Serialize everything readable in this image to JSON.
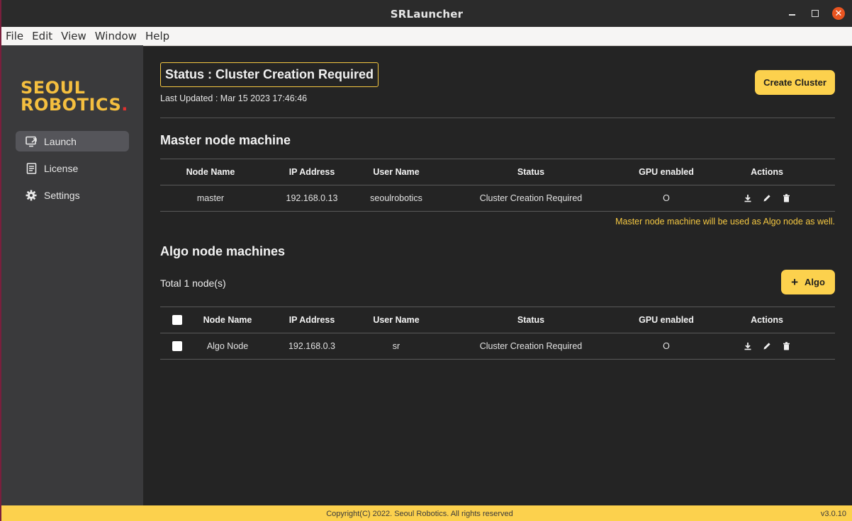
{
  "window": {
    "title": "SRLauncher"
  },
  "menu": {
    "items": [
      "File",
      "Edit",
      "View",
      "Window",
      "Help"
    ]
  },
  "sidebar": {
    "logo_line1": "SEOUL",
    "logo_line2": "ROBOTICS",
    "logo_dot": ".",
    "items": [
      {
        "label": "Launch",
        "icon": "launch-icon",
        "active": true
      },
      {
        "label": "License",
        "icon": "license-icon",
        "active": false
      },
      {
        "label": "Settings",
        "icon": "gear-icon",
        "active": false
      }
    ]
  },
  "header": {
    "status": "Status : Cluster Creation Required",
    "last_updated": "Last Updated : Mar 15 2023 17:46:46",
    "create_button": "Create Cluster"
  },
  "master": {
    "title": "Master node machine",
    "columns": [
      "Node Name",
      "IP Address",
      "User Name",
      "Status",
      "GPU enabled",
      "Actions"
    ],
    "rows": [
      {
        "node_name": "master",
        "ip": "192.168.0.13",
        "user": "seoulrobotics",
        "status": "Cluster Creation Required",
        "gpu": "O"
      }
    ],
    "note": "Master node machine will be used as Algo node as well."
  },
  "algo": {
    "title": "Algo node machines",
    "total": "Total 1 node(s)",
    "add_button": "Algo",
    "columns": [
      "Node Name",
      "IP Address",
      "User Name",
      "Status",
      "GPU enabled",
      "Actions"
    ],
    "rows": [
      {
        "node_name": "Algo Node",
        "ip": "192.168.0.3",
        "user": "sr",
        "status": "Cluster Creation Required",
        "gpu": "O"
      }
    ]
  },
  "footer": {
    "copyright": "Copyright(C) 2022. Seoul Robotics. All rights reserved",
    "version": "v3.0.10"
  },
  "colors": {
    "accent": "#fcd14d",
    "logo": "#f5bf3f",
    "background": "#242424",
    "sidebar": "#3a3a3c"
  }
}
